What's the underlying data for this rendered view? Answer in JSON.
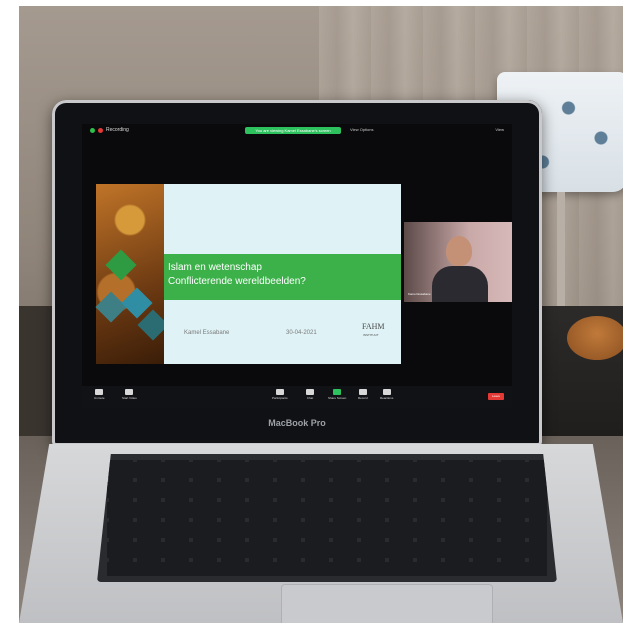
{
  "zoom": {
    "recording_label": "Recording",
    "share_banner": "You are viewing Kamel Essabane's screen",
    "view_options": "View Options",
    "view_mode": "View",
    "participant_name": "Kamel Essabane",
    "toolbar": [
      {
        "label": "Unmute",
        "icon": "microphone-icon"
      },
      {
        "label": "Start Video",
        "icon": "camera-icon"
      },
      {
        "label": "Participants",
        "icon": "people-icon"
      },
      {
        "label": "Chat",
        "icon": "chat-icon"
      },
      {
        "label": "Share Screen",
        "icon": "share-screen-icon",
        "accent": "#2ec25e"
      },
      {
        "label": "Record",
        "icon": "record-icon"
      },
      {
        "label": "Reactions",
        "icon": "reactions-icon"
      }
    ],
    "leave_label": "Leave"
  },
  "slide": {
    "title": "Islam en wetenschap",
    "subtitle": "Conflicterende wereldbeelden?",
    "speaker": "Kamel Essabane",
    "date": "30-04-2021",
    "logo": "FAHM",
    "logo_sub": "INSTITUUT"
  },
  "laptop": {
    "brand": "MacBook Pro"
  },
  "colors": {
    "slide_green": "#3cb14a",
    "slide_bg": "#dff2f6",
    "leave_red": "#e53935"
  }
}
